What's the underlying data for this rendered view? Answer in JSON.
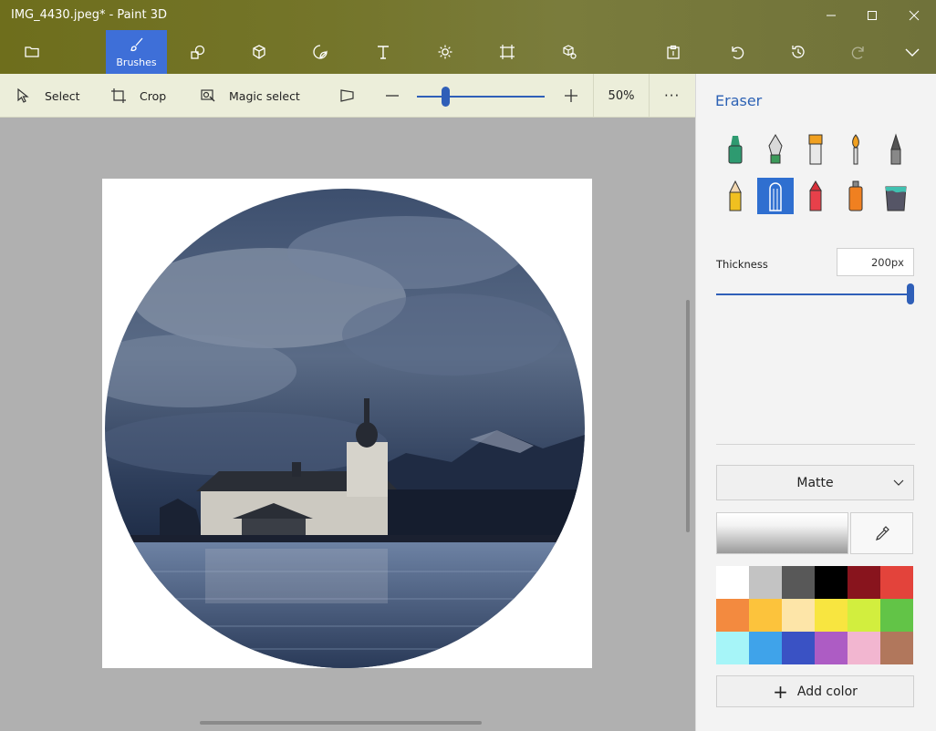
{
  "window": {
    "title": "IMG_4430.jpeg* - Paint 3D"
  },
  "ribbon": {
    "items": [
      {
        "name": "menu-button",
        "icon": "folder-icon",
        "label": ""
      },
      {
        "name": "brushes-tab",
        "icon": "brush-icon",
        "label": "Brushes"
      },
      {
        "name": "2d-shapes-tab",
        "icon": "shapes-icon",
        "label": ""
      },
      {
        "name": "3d-shapes-tab",
        "icon": "cube-icon",
        "label": ""
      },
      {
        "name": "stickers-tab",
        "icon": "sticker-icon",
        "label": ""
      },
      {
        "name": "text-tab",
        "icon": "text-icon",
        "label": ""
      },
      {
        "name": "effects-tab",
        "icon": "sun-icon",
        "label": ""
      },
      {
        "name": "canvas-tab",
        "icon": "crop-frame-icon",
        "label": ""
      },
      {
        "name": "3d-library-tab",
        "icon": "3d-library-icon",
        "label": ""
      }
    ],
    "active": "Brushes"
  },
  "toolbar": {
    "select_label": "Select",
    "crop_label": "Crop",
    "magic_select_label": "Magic select",
    "zoom_percent": "50%",
    "zoom_level": 0.22,
    "more_label": "···"
  },
  "panel": {
    "title": "Eraser",
    "brushes": [
      {
        "icon": "marker-icon",
        "selected": false
      },
      {
        "icon": "calligraphy-pen-icon",
        "selected": false
      },
      {
        "icon": "oil-brush-icon",
        "selected": false
      },
      {
        "icon": "watercolor-icon",
        "selected": false
      },
      {
        "icon": "pixel-pen-icon",
        "selected": false
      },
      {
        "icon": "pencil-icon",
        "selected": false
      },
      {
        "icon": "eraser-icon",
        "selected": true
      },
      {
        "icon": "crayon-icon",
        "selected": false
      },
      {
        "icon": "spray-can-icon",
        "selected": false
      },
      {
        "icon": "fill-bucket-icon",
        "selected": false
      }
    ],
    "thickness_label": "Thickness",
    "thickness_value": "200px",
    "thickness_level": 1.0,
    "finish": "Matte",
    "palette": [
      "#ffffff",
      "#c3c3c3",
      "#585858",
      "#000000",
      "#88141d",
      "#e3433b",
      "#f38a3f",
      "#fcc33c",
      "#fde5a8",
      "#f8e540",
      "#d2ee3e",
      "#62c447",
      "#a6f5f8",
      "#3fa3ea",
      "#3a52c4",
      "#ad5cc4",
      "#f2b6d0",
      "#b1775c"
    ],
    "add_color_label": "Add color"
  },
  "colors": {
    "accent": "#2f6fd0",
    "title_text": "#2d62b5"
  }
}
